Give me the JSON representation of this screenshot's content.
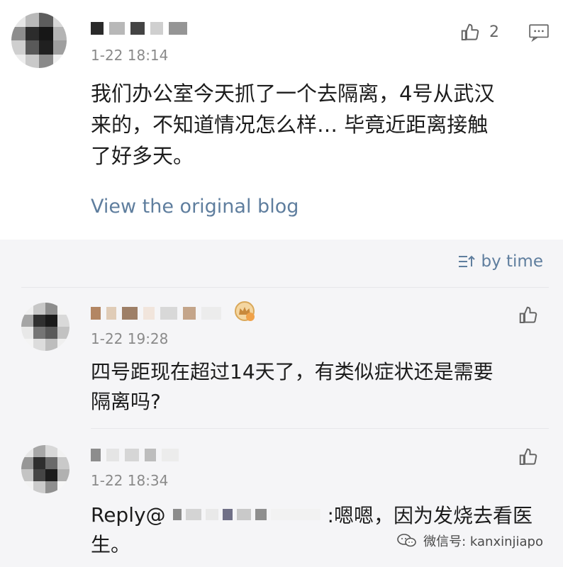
{
  "post": {
    "time": "1-22 18:14",
    "like_count": "2",
    "text_lines": [
      "我们办公室今天抓了一个去隔离，4号从武汉",
      "来的，不知道情况怎么样… 毕竟近距离接触",
      "了好多天。"
    ],
    "view_original": "View the original blog"
  },
  "sort": {
    "label": "by time"
  },
  "comments": [
    {
      "time": "1-22 19:28",
      "text_lines": [
        "四号距现在超过14天了，有类似症状还是需要",
        "隔离吗?"
      ]
    },
    {
      "time": "1-22 18:34",
      "reply_prefix": "Reply@",
      "reply_suffix": ":嗯嗯，因为发烧去看医",
      "continuation": "生。"
    }
  ],
  "watermark": {
    "text": "微信号: kanxinjiapo"
  },
  "colors": {
    "background": "#f5f5f7",
    "card": "#ffffff",
    "link": "#5f7e9e",
    "meta": "#8a8a8a",
    "text": "#1c1c1c"
  },
  "icons": [
    "thumbs-up-icon",
    "comment-icon",
    "sort-icon",
    "crown-icon",
    "wechat-icon"
  ]
}
